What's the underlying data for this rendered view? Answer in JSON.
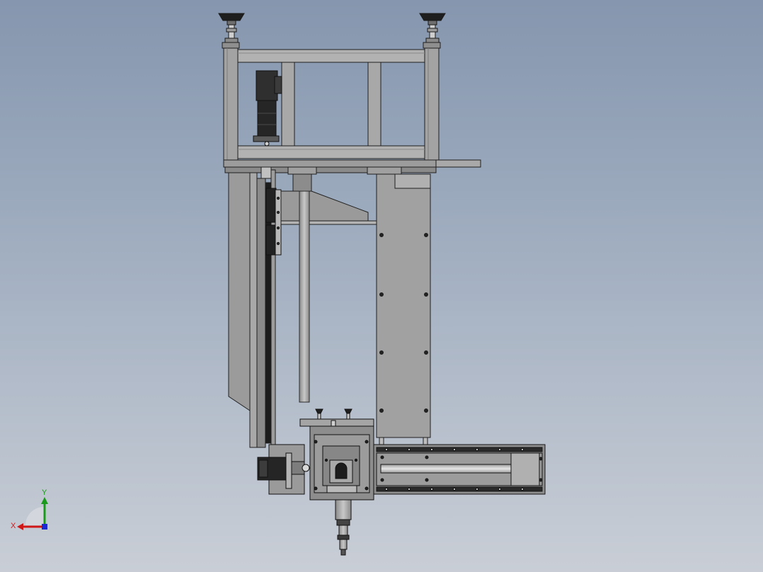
{
  "triad": {
    "x_label": "X",
    "y_label": "Y",
    "x_color": "#d01818",
    "y_color": "#1a9a1a",
    "z_color": "#1a2ad0"
  },
  "colors": {
    "background_top": "#8596ae",
    "background_bottom": "#c9ced6",
    "metal_light": "#b4b4b4",
    "metal_mid": "#9a9a9a",
    "metal_dark": "#7a7a7a",
    "edge": "#202020",
    "motor": "#2d2d2d"
  }
}
